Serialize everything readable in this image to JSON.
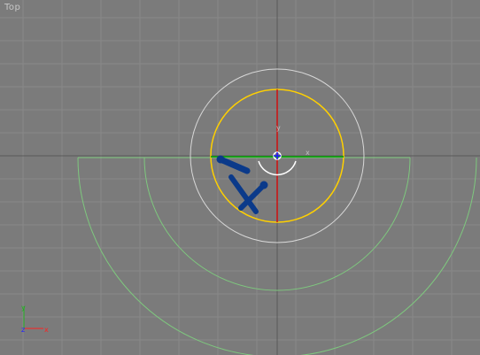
{
  "viewport": {
    "label": "Top",
    "background": "#7b7b7b",
    "grid_color": "#8a8a8a",
    "grid_major_color": "#555555"
  },
  "gizmo": {
    "axis_x_label": "x",
    "axis_y_label": "y",
    "x_color": "#d01010",
    "y_color": "#00a000",
    "z_color": "#1a1aff"
  },
  "view_axes": {
    "x_label": "x",
    "y_label": "y",
    "z_label": "z",
    "x_color": "#ff2020",
    "y_color": "#20b020",
    "z_color": "#2020ff"
  },
  "rotate_gizmo": {
    "outer_ring_color": "#e0e0e0",
    "active_ring_color": "#ffd000",
    "x_axis_color": "#d01010",
    "y_axis_color": "#00a000"
  },
  "object": {
    "color": "#0b3a8a",
    "arc_color": "#7ec87e"
  }
}
